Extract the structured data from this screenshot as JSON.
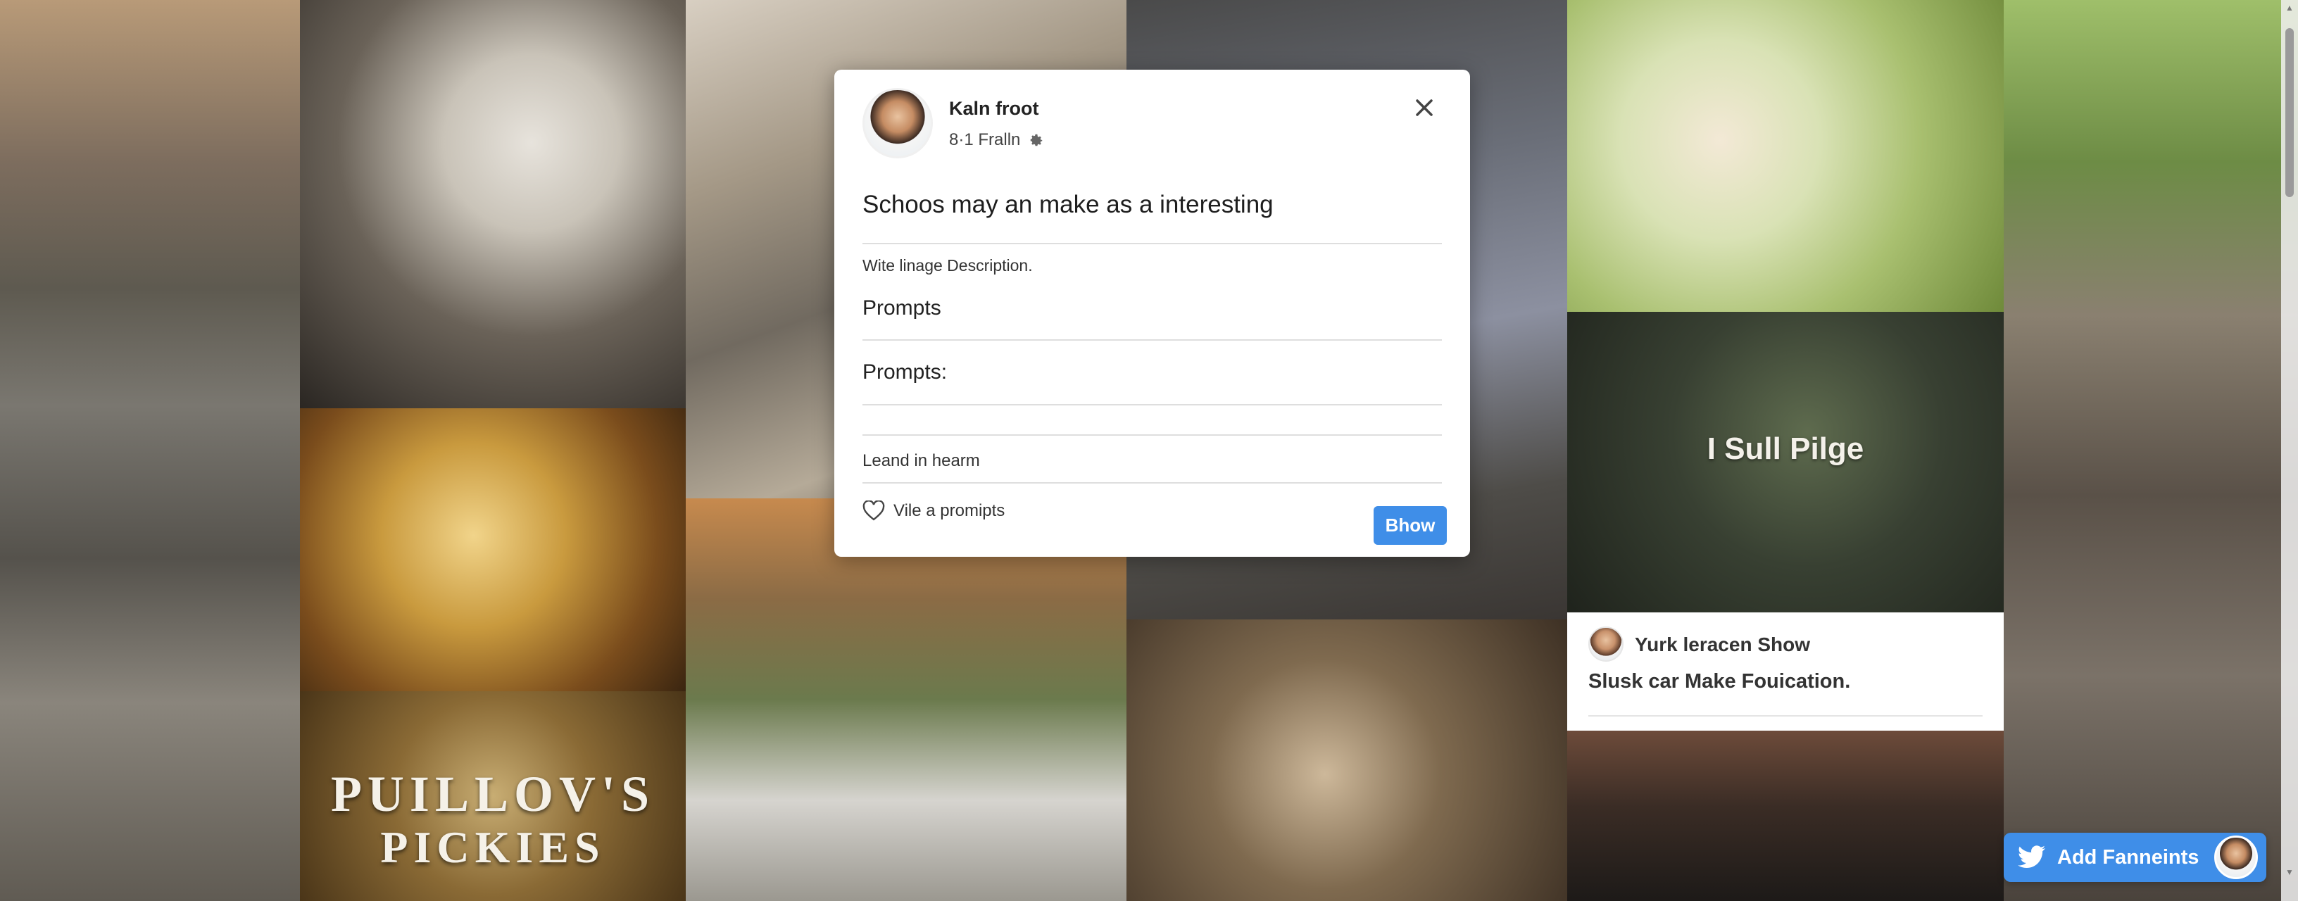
{
  "tiles": {
    "promo_text": "I Sull Pilge",
    "pickles_line1": "PUILLOV'S",
    "pickles_line2": "PICKIES"
  },
  "info_card": {
    "name": "Yurk leracen Show",
    "subtitle": "Slusk car Make Fouication."
  },
  "modal": {
    "user_name": "Kaln froot",
    "meta": "8·1 Fralln",
    "title": "Schoos may an make as a interesting",
    "description": "Wite linage Description.",
    "field1_label": "Prompts",
    "field2_label": "Prompts:",
    "learn_label": "Leand in hearm",
    "like_label": "Vile a promipts",
    "show_button": "Bhow"
  },
  "fab": {
    "label": "Add Fanneints"
  },
  "colors": {
    "accent": "#3f8ee8",
    "modal_bg": "#ffffff",
    "divider": "#dedede"
  },
  "icons": [
    "gear-icon",
    "close-icon",
    "heart-icon",
    "bird-icon"
  ]
}
